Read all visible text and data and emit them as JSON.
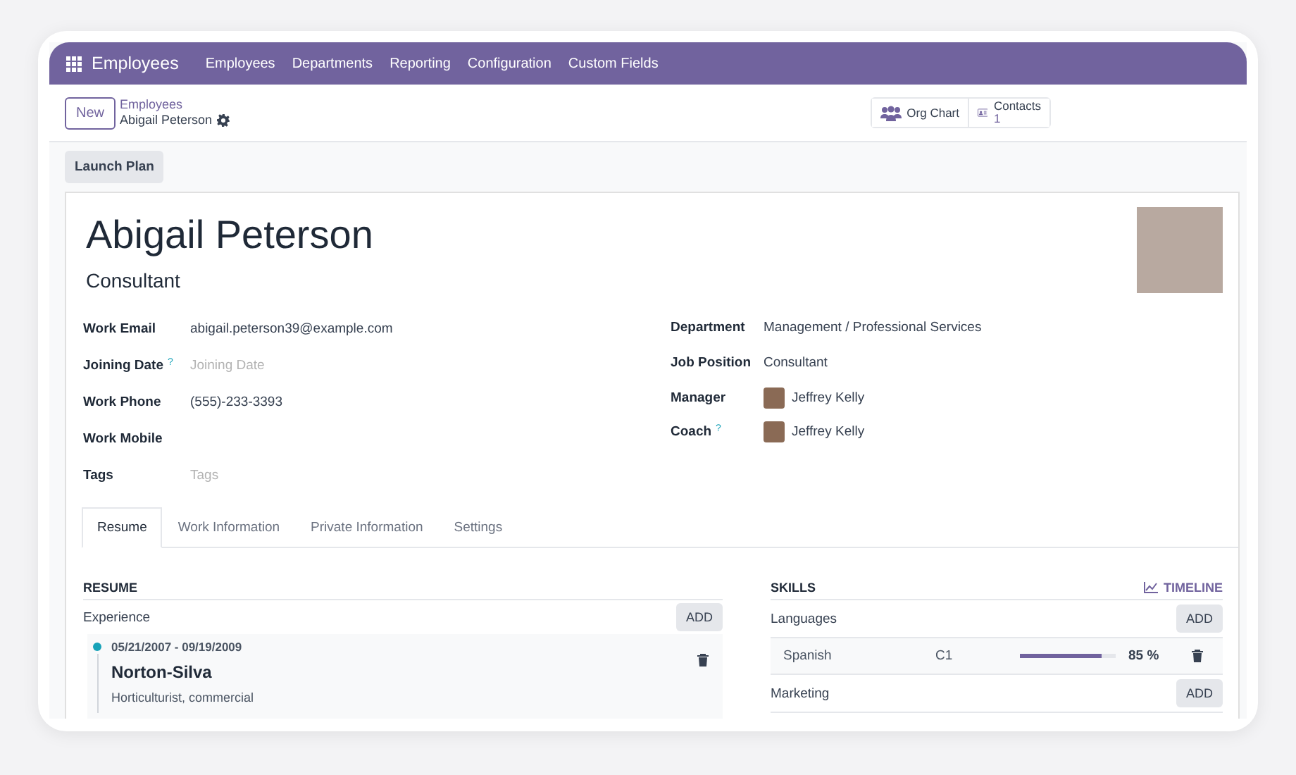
{
  "navbar": {
    "app_name": "Employees",
    "menu": [
      "Employees",
      "Departments",
      "Reporting",
      "Configuration",
      "Custom Fields"
    ]
  },
  "control_panel": {
    "new_button": "New",
    "breadcrumb": "Employees",
    "record_name": "Abigail Peterson",
    "smart_buttons": [
      {
        "kind": "org_chart",
        "label": "Org Chart"
      },
      {
        "kind": "contacts",
        "label": "Contacts",
        "count": "1"
      }
    ]
  },
  "action_buttons": [
    "Launch Plan"
  ],
  "employee": {
    "name": "Abigail Peterson",
    "job_title": "Consultant"
  },
  "fields_left": [
    {
      "kind": "text",
      "label": "Work Email",
      "value": "abigail.peterson39@example.com"
    },
    {
      "kind": "empty",
      "label": "Joining Date",
      "help": "?",
      "placeholder": "Joining Date"
    },
    {
      "kind": "text",
      "label": "Work Phone",
      "value": "(555)-233-3393"
    },
    {
      "kind": "empty",
      "label": "Work Mobile"
    },
    {
      "kind": "empty",
      "label": "Tags",
      "placeholder": "Tags"
    }
  ],
  "fields_right": [
    {
      "kind": "text",
      "label": "Department",
      "value": "Management / Professional Services"
    },
    {
      "kind": "text",
      "label": "Job Position",
      "value": "Consultant"
    },
    {
      "kind": "user",
      "label": "Manager",
      "value": "Jeffrey Kelly"
    },
    {
      "kind": "user",
      "label": "Coach",
      "help": "?",
      "value": "Jeffrey Kelly"
    }
  ],
  "tabs": [
    {
      "label": "Resume",
      "selected": true
    },
    {
      "label": "Work Information",
      "selected": false
    },
    {
      "label": "Private Information",
      "selected": false
    },
    {
      "label": "Settings",
      "selected": false
    }
  ],
  "resume": {
    "title": "RESUME",
    "sections": [
      {
        "name": "Experience",
        "add": "ADD",
        "entries": [
          {
            "dates": "05/21/2007 - 09/19/2009",
            "company": "Norton-Silva",
            "description": "Horticulturist, commercial"
          }
        ]
      }
    ]
  },
  "skills": {
    "title": "SKILLS",
    "timeline": "TIMELINE",
    "groups": [
      {
        "name": "Languages",
        "add": "ADD",
        "skills": [
          {
            "name": "Spanish",
            "level_name": "C1",
            "level": 0.85,
            "reading": "85 %"
          }
        ]
      },
      {
        "name": "Marketing",
        "add": "ADD"
      }
    ]
  }
}
